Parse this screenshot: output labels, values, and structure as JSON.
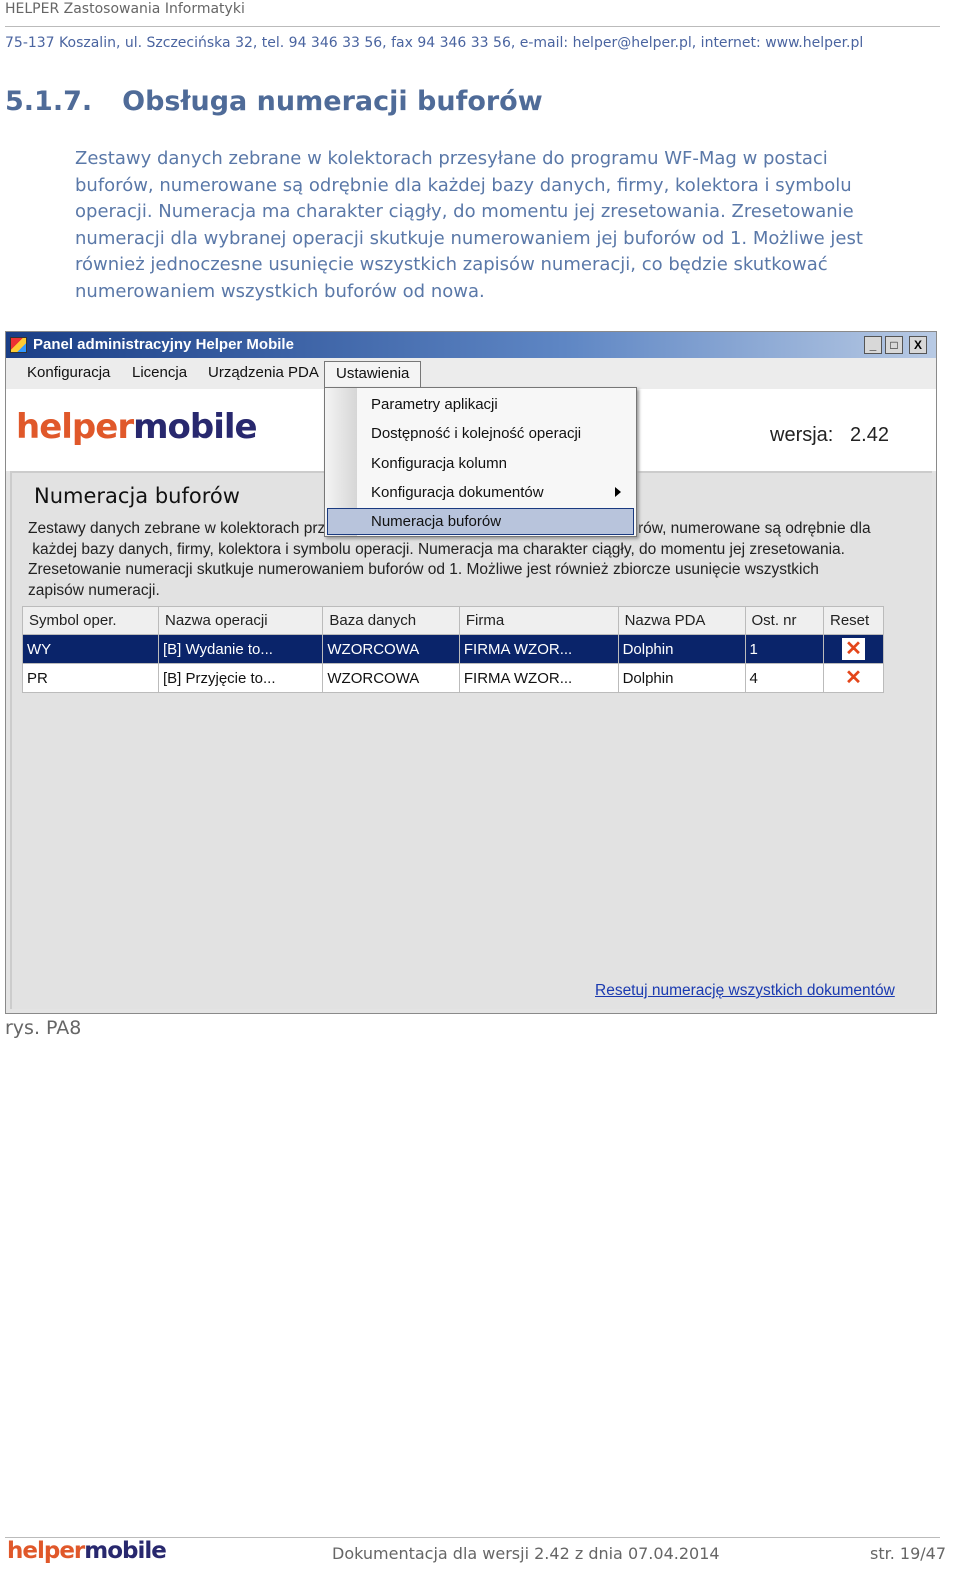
{
  "header": {
    "company": "HELPER Zastosowania Informatyki",
    "address": "75-137 Koszalin, ul. Szczecińska 32,  tel. 94 346 33 56,  fax 94 346 33 56,  e-mail: helper@helper.pl,  internet: www.helper.pl"
  },
  "section": {
    "number": "5.1.7.",
    "title": "Obsługa numeracji buforów"
  },
  "paragraph": [
    "Zestawy danych zebrane w kolektorach przesyłane do programu WF-Mag w postaci",
    "buforów, numerowane są odrębnie dla każdej bazy danych, firmy, kolektora i symbolu",
    "operacji. Numeracja ma charakter ciągły, do momentu jej zresetowania. Zresetowanie",
    "numeracji dla wybranej operacji skutkuje numerowaniem jej buforów od 1. Możliwe jest",
    "również jednoczesne usunięcie wszystkich zapisów numeracji, co będzie skutkować",
    "numerowaniem wszystkich buforów od nowa."
  ],
  "window": {
    "title": "Panel administracyjny Helper Mobile",
    "controls": [
      "_",
      "□",
      "X"
    ],
    "menu": [
      "Konfiguracja",
      "Licencja",
      "Urządzenia PDA",
      "Ustawienia"
    ],
    "dropdown": [
      "Parametry aplikacji",
      "Dostępność i kolejność operacji",
      "Konfiguracja kolumn",
      "Konfiguracja dokumentów",
      "Numeracja buforów"
    ],
    "logo": {
      "part1": "helper",
      "part2": "mobile"
    },
    "version_label": "wersja:",
    "version": "2.42",
    "panel_title": "Numeracja buforów",
    "panel_text": [
      "Zestawy danych zebrane w kolektorach przesyłane do programu WF-Mag w postaci buforów, numerowane są odrębnie dla",
      " każdej bazy danych, firmy, kolektora i symbolu operacji. Numeracja ma charakter ciągły, do momentu jej zresetowania.",
      "Zresetowanie numeracji skutkuje numerowaniem buforów od 1. Możliwe jest również zbiorcze usunięcie wszystkich",
      "zapisów numeracji."
    ],
    "table": {
      "columns": [
        "Symbol oper.",
        "Nazwa operacji",
        "Baza danych",
        "Firma",
        "Nazwa PDA",
        "Ost. nr",
        "Reset"
      ],
      "rows": [
        [
          "WY",
          "[B] Wydanie to...",
          "WZORCOWA",
          "FIRMA WZOR...",
          "Dolphin",
          "1"
        ],
        [
          "PR",
          "[B] Przyjęcie to...",
          "WZORCOWA",
          "FIRMA WZOR...",
          "Dolphin",
          "4"
        ]
      ],
      "selected_row": 0,
      "reset_icon": "x-icon",
      "reset_color": "#e4461a"
    },
    "reset_all_link": "Resetuj numerację wszystkich dokumentów"
  },
  "caption": "rys. PA8",
  "footer": {
    "logo1": "helper",
    "logo2": "mobile",
    "text": "Dokumentacja dla wersji 2.42 z dnia 07.04.2014",
    "page": "str. 19/47"
  }
}
